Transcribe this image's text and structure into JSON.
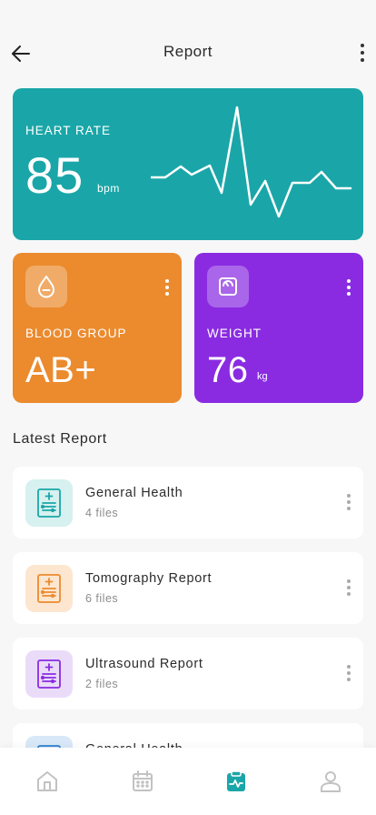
{
  "header": {
    "title": "Report"
  },
  "heart_rate": {
    "label": "HEART RATE",
    "value": "85",
    "unit": "bpm"
  },
  "blood_group": {
    "label": "BLOOD GROUP",
    "value": "AB+"
  },
  "weight": {
    "label": "WEIGHT",
    "value": "76",
    "unit": "kg"
  },
  "latest": {
    "title": "Latest Report",
    "items": [
      {
        "name": "General Health",
        "count": "4 files"
      },
      {
        "name": "Tomography Report",
        "count": "6 files"
      },
      {
        "name": "Ultrasound Report",
        "count": "2 files"
      },
      {
        "name": "General Health",
        "count": ""
      }
    ]
  },
  "colors": {
    "teal": "#1aa6a8",
    "orange": "#eb8b2e",
    "purple": "#8a2be2"
  },
  "icons": [
    "back-arrow-icon",
    "more-vertical-icon",
    "blood-drop-icon",
    "scale-icon",
    "clipboard-report-icon",
    "home-icon",
    "calendar-icon",
    "activity-clipboard-icon",
    "user-icon"
  ]
}
